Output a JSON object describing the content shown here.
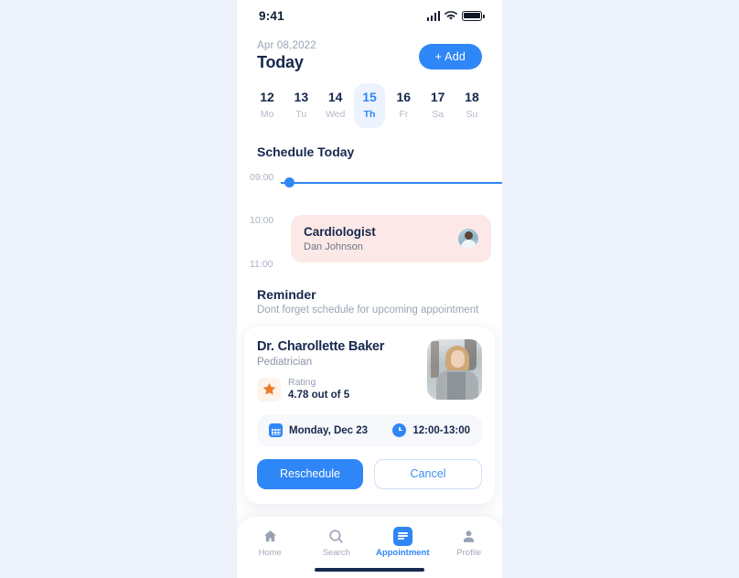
{
  "status_bar": {
    "time": "9:41",
    "signal_icon": "cellular-signal-icon",
    "wifi_icon": "wifi-icon",
    "battery_icon": "battery-icon"
  },
  "header": {
    "date": "Apr 08,2022",
    "title": "Today",
    "add_label": "+ Add"
  },
  "week_strip": [
    {
      "num": "12",
      "name": "Mo",
      "active": false
    },
    {
      "num": "13",
      "name": "Tu",
      "active": false
    },
    {
      "num": "14",
      "name": "Wed",
      "active": false
    },
    {
      "num": "15",
      "name": "Th",
      "active": true
    },
    {
      "num": "16",
      "name": "Fr",
      "active": false
    },
    {
      "num": "17",
      "name": "Sa",
      "active": false
    },
    {
      "num": "18",
      "name": "Su",
      "active": false
    }
  ],
  "schedule": {
    "title": "Schedule Today",
    "times": [
      "09:00",
      "10:00",
      "11:00"
    ],
    "appointment": {
      "role": "Cardiologist",
      "person": "Dan Johnson"
    }
  },
  "reminder": {
    "title": "Reminder",
    "subtitle": "Dont forget schedule for upcoming appointment",
    "doctor_name": "Dr. Charollette Baker",
    "specialty": "Pediatrician",
    "rating_label": "Rating",
    "rating_value": "4.78 out of 5",
    "date": "Monday, Dec 23",
    "time": "12:00-13:00",
    "reschedule_label": "Reschedule",
    "cancel_label": "Cancel"
  },
  "bottom_nav": [
    {
      "label": "Home",
      "icon": "home-icon",
      "active": false
    },
    {
      "label": "Search",
      "icon": "search-icon",
      "active": false
    },
    {
      "label": "Appointment",
      "icon": "appointment-icon",
      "active": true
    },
    {
      "label": "Profile",
      "icon": "profile-icon",
      "active": false
    }
  ],
  "colors": {
    "accent": "#2f86f6",
    "dark": "#16284d",
    "muted": "#9aa3b5",
    "card_pink": "#fce9e7",
    "star": "#ef7b2a"
  }
}
